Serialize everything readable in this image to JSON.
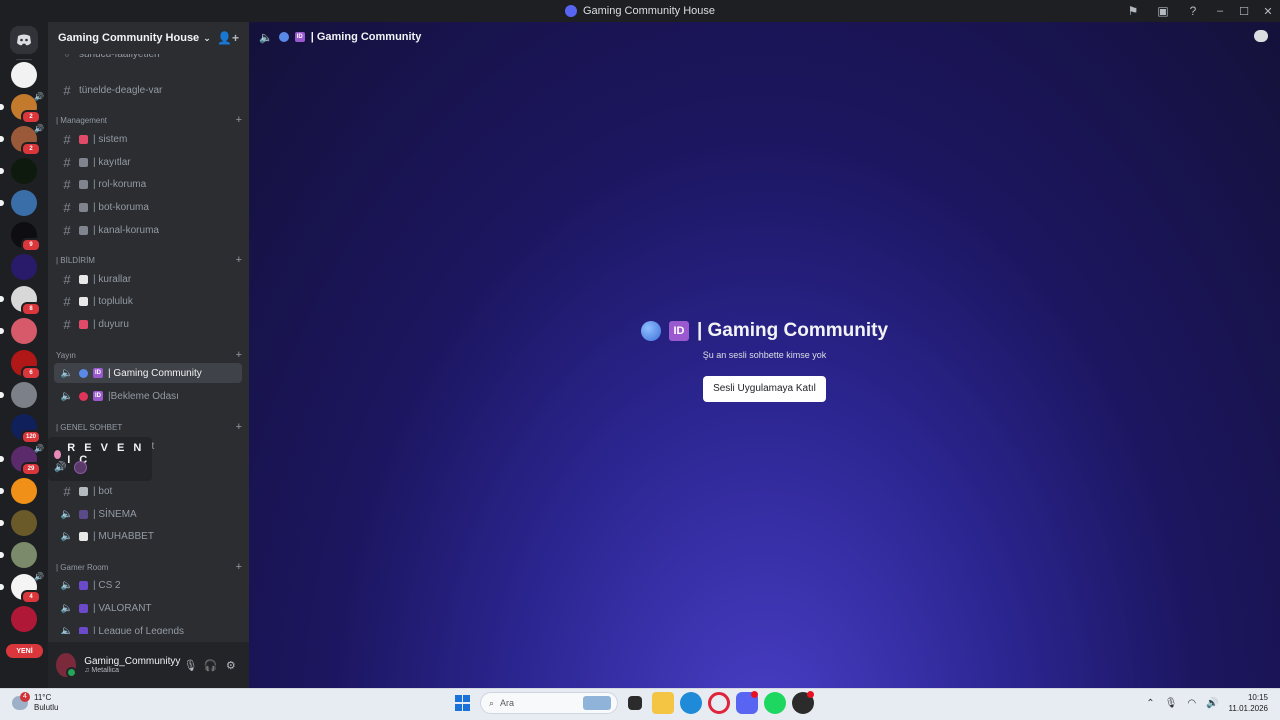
{
  "window": {
    "title": "Gaming Community House"
  },
  "rail": {
    "new_label": "YENİ",
    "servers": [
      {
        "color": "#f2f2f2",
        "fg": "#222",
        "badge": "",
        "pill": false,
        "voice": false
      },
      {
        "color": "#c47a2c",
        "fg": "#fff",
        "badge": "2",
        "pill": true,
        "voice": true
      },
      {
        "color": "#9a5a3a",
        "fg": "#fff",
        "badge": "2",
        "pill": true,
        "voice": true
      },
      {
        "color": "#0d1a0d",
        "fg": "#5f5",
        "badge": "",
        "pill": true,
        "voice": false
      },
      {
        "color": "#3a6ea8",
        "fg": "#fff",
        "badge": "",
        "pill": true,
        "voice": false
      },
      {
        "color": "#0e0e12",
        "fg": "#fff",
        "badge": "9",
        "pill": false,
        "voice": false
      },
      {
        "color": "#2a1a6a",
        "fg": "#a7f",
        "badge": "",
        "pill": false,
        "voice": false
      },
      {
        "color": "#d8d8d8",
        "fg": "#222",
        "badge": "8",
        "pill": true,
        "voice": false
      },
      {
        "color": "#d65a6a",
        "fg": "#fff",
        "badge": "",
        "pill": true,
        "voice": false
      },
      {
        "color": "#b01818",
        "fg": "#fff",
        "badge": "6",
        "pill": false,
        "voice": false
      },
      {
        "color": "#7c8088",
        "fg": "#fff",
        "badge": "",
        "pill": true,
        "voice": false
      },
      {
        "color": "#10205a",
        "fg": "#fff",
        "badge": "120",
        "pill": false,
        "voice": false
      },
      {
        "color": "#5a2a6a",
        "fg": "#fff",
        "badge": "29",
        "pill": true,
        "voice": true
      },
      {
        "color": "#f09018",
        "fg": "#fff",
        "badge": "",
        "pill": true,
        "voice": false
      },
      {
        "color": "#6a5a2a",
        "fg": "#fff",
        "badge": "",
        "pill": true,
        "voice": false
      },
      {
        "color": "#7a8a6a",
        "fg": "#fff",
        "badge": "",
        "pill": true,
        "voice": false
      },
      {
        "color": "#f4f4f4",
        "fg": "#222",
        "badge": "4",
        "pill": true,
        "voice": true
      },
      {
        "color": "#b01838",
        "fg": "#fff",
        "badge": "",
        "pill": false,
        "voice": false
      }
    ]
  },
  "sidebar": {
    "server_name": "Gaming Community House",
    "top_partial_channel": "sunucu-faaliyetleri",
    "channels_a": [
      {
        "name": "tünelde-deagle-var",
        "icon": "hash",
        "emoji": ""
      }
    ],
    "cat_management": "| Management",
    "management": [
      {
        "name": "| sistem",
        "icon": "hash",
        "emoji": "#e24a6a"
      },
      {
        "name": "| kayıtlar",
        "icon": "hash",
        "emoji": "#80848e"
      },
      {
        "name": "| rol-koruma",
        "icon": "hash",
        "emoji": "#80848e"
      },
      {
        "name": "| bot-koruma",
        "icon": "hash",
        "emoji": "#80848e"
      },
      {
        "name": "| kanal-koruma",
        "icon": "hash",
        "emoji": "#80848e"
      }
    ],
    "cat_bildirim": "| BİLDİRİM",
    "bildirim": [
      {
        "name": "| kurallar",
        "icon": "hash",
        "emoji": "#e8e8e8"
      },
      {
        "name": "| topluluk",
        "icon": "hash",
        "emoji": "#e8e8e8"
      },
      {
        "name": "| duyuru",
        "icon": "hash",
        "emoji": "#e24a6a"
      }
    ],
    "cat_yayin": "Yayın",
    "yayin": [
      {
        "name": "| Gaming Community",
        "icon": "speaker",
        "active": true
      },
      {
        "name": "|Bekleme Odası",
        "icon": "speaker",
        "active": false
      }
    ],
    "cat_genel": "| GENEL SOHBET",
    "genel_partial": "et",
    "genel": [
      {
        "name": "| bot",
        "icon": "hash",
        "emoji": "#b5bac1"
      },
      {
        "name": "| SİNEMA",
        "icon": "speaker",
        "emoji": "#5a4a8a"
      },
      {
        "name": "| MUHABBET",
        "icon": "speaker",
        "emoji": "#e8e8e8"
      }
    ],
    "cat_gamer": "| Gamer Room",
    "gamer": [
      {
        "name": "| CS 2",
        "icon": "speaker",
        "emoji": "#6a4ac8"
      },
      {
        "name": "| VALORANT",
        "icon": "speaker",
        "emoji": "#6a4ac8"
      },
      {
        "name": "| League of Legends",
        "icon": "speaker",
        "emoji": "#6a4ac8"
      }
    ]
  },
  "hovercard": {
    "name": "R E V E N I C"
  },
  "user": {
    "name": "Gaming_Communityy",
    "status": "♫ Metallica"
  },
  "main": {
    "header_title": "| Gaming Community",
    "center_title": "| Gaming Community",
    "subtitle": "Şu an sesli sohbette kimse yok",
    "join_button": "Sesli Uygulamaya Katıl"
  },
  "taskbar": {
    "weather_temp": "11°C",
    "weather_desc": "Bulutlu",
    "weather_badge": "4",
    "search_placeholder": "Ara",
    "time": "10:15",
    "date": "11.01.2026"
  }
}
